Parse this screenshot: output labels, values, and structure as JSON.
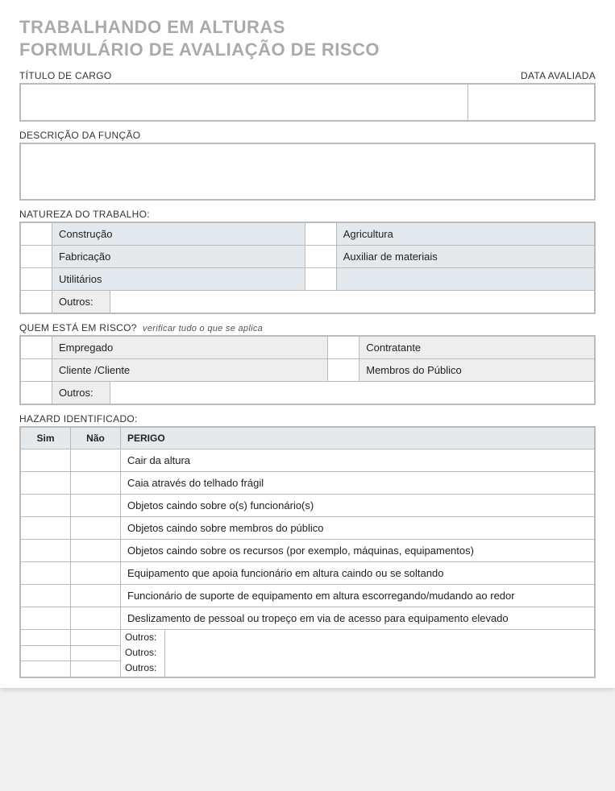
{
  "title_line1": "TRABALHANDO EM ALTURAS",
  "title_line2": "FORMULÁRIO DE AVALIAÇÃO DE RISCO",
  "labels": {
    "titulo_cargo": "TÍTULO DE CARGO",
    "data_avaliada": "DATA AVALIADA",
    "descricao_funcao": "DESCRIÇÃO DA FUNÇÃO",
    "natureza_trabalho": "NATUREZA DO TRABALHO:",
    "quem_risco": "QUEM ESTÁ EM RISCO?",
    "quem_risco_sub": "verificar tudo o que se aplica",
    "hazard_identificado": "HAZARD IDENTIFICADO:",
    "outros": "Outros:",
    "sim": "Sim",
    "nao": "Não",
    "perigo": "PERIGO"
  },
  "natureza": {
    "r1a": "Construção",
    "r1b": "Agricultura",
    "r2a": "Fabricação",
    "r2b": "Auxiliar de materiais",
    "r3a": "Utilitários"
  },
  "risco": {
    "r1a": "Empregado",
    "r1b": "Contratante",
    "r2a": "Cliente /Cliente",
    "r2b": "Membros do Público"
  },
  "hazards": [
    "Cair da altura",
    "Caia através do telhado frágil",
    "Objetos caindo sobre o(s) funcionário(s)",
    "Objetos caindo sobre membros do público",
    "Objetos caindo sobre os recursos (por exemplo, máquinas, equipamentos)",
    "Equipamento que apoia funcionário em altura caindo ou se soltando",
    "Funcionário de suporte de equipamento em altura escorregando/mudando ao redor",
    "Deslizamento de pessoal ou tropeço em via de acesso para equipamento elevado"
  ],
  "outros_lines": [
    "Outros:",
    "Outros:",
    "Outros:"
  ]
}
